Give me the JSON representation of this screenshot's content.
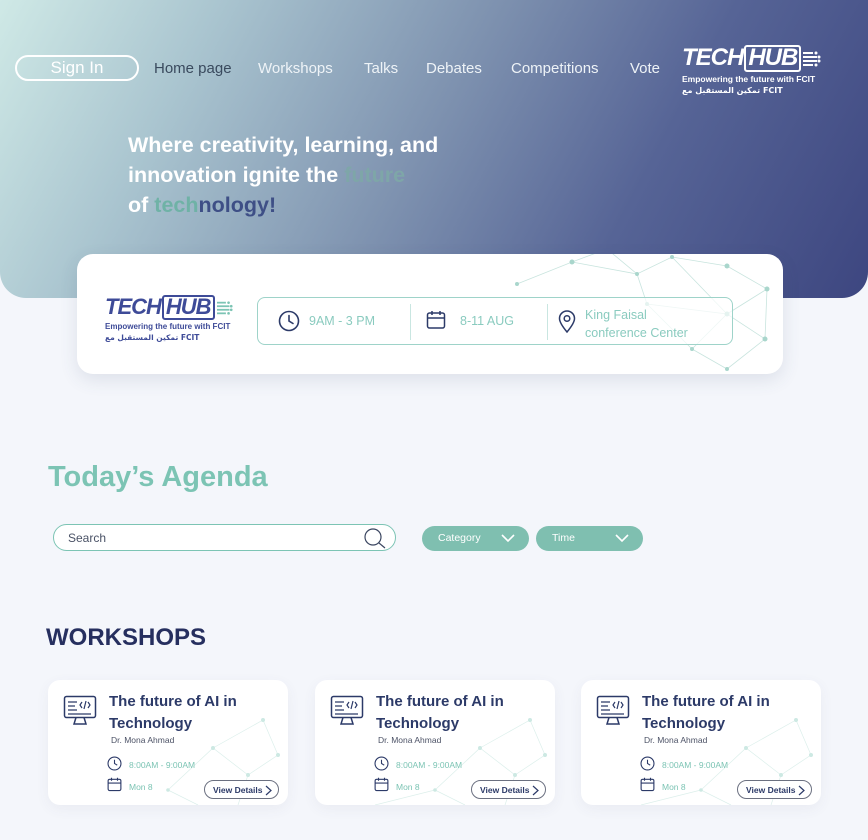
{
  "nav": {
    "signin": "Sign In",
    "items": [
      "Home page",
      "Workshops",
      "Talks",
      "Debates",
      "Competitions",
      "Vote"
    ]
  },
  "logo": {
    "tech": "TECH",
    "hub": "HUB",
    "tagline": "Empowering the future with FCIT",
    "arabic": "تمكين المستقبل مع FCIT"
  },
  "hero": {
    "line1": "Where creativity, learning, and",
    "line2a": "innovation ignite the ",
    "line2b": "future",
    "line3a": "of ",
    "line3b": "tech",
    "line3c": "nology!"
  },
  "event": {
    "time": "9AM - 3 PM",
    "date": "8-11 AUG",
    "location_line1": "King Faisal",
    "location_line2": "conference Center"
  },
  "agenda": {
    "title": "Today’s Agenda",
    "search_placeholder": "Search",
    "filters": [
      "Category",
      "Time"
    ]
  },
  "workshops": {
    "title": "WORKSHOPS",
    "cards": [
      {
        "title": "The future of AI in Technology",
        "speaker": "Dr. Mona Ahmad",
        "time": "8:00AM - 9:00AM",
        "date": "Mon  8",
        "button": "View Details"
      },
      {
        "title": "The future of AI in Technology",
        "speaker": "Dr. Mona Ahmad",
        "time": "8:00AM - 9:00AM",
        "date": "Mon  8",
        "button": "View Details"
      },
      {
        "title": "The future of AI in Technology",
        "speaker": "Dr. Mona Ahmad",
        "time": "8:00AM - 9:00AM",
        "date": "Mon  8",
        "button": "View Details"
      }
    ]
  },
  "colors": {
    "accent": "#7cc4b4",
    "navy": "#2c3a68",
    "hero_start": "#cfe9e6",
    "hero_end": "#3d4680"
  },
  "icons": [
    "clock-icon",
    "calendar-icon",
    "location-pin-icon",
    "search-icon",
    "chevron-down-icon",
    "code-monitor-icon",
    "chevron-right-icon"
  ]
}
